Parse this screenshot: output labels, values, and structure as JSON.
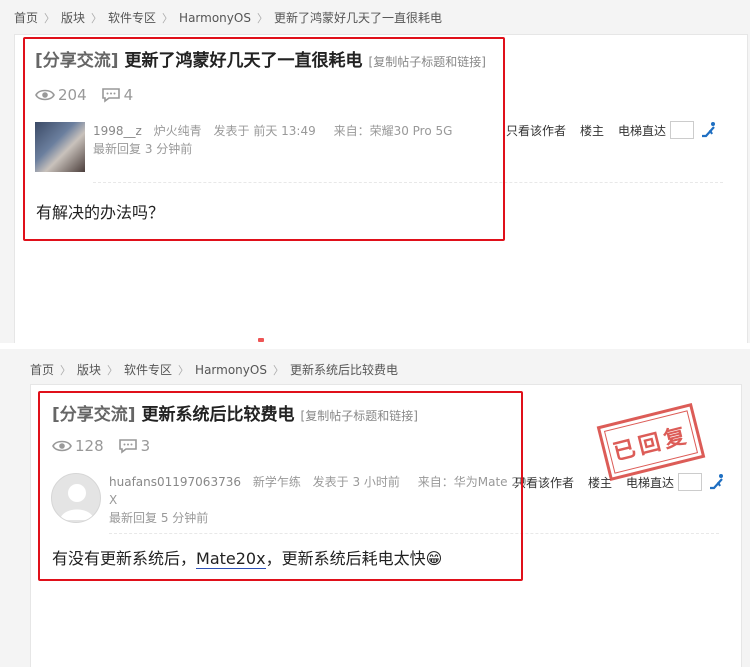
{
  "top": {
    "breadcrumb": [
      "首页",
      "版块",
      "软件专区",
      "HarmonyOS",
      "更新了鸿蒙好几天了一直很耗电"
    ],
    "post": {
      "category": "[分享交流]",
      "title": "更新了鸿蒙好几天了一直很耗电",
      "copy_link": "[复制帖子标题和链接]",
      "views": "204",
      "replies": "4",
      "username": "1998__z",
      "user_level": "炉火纯青",
      "posted": "发表于 前天 13:49",
      "source": "来自：荣耀30 Pro 5G",
      "last_reply": "最新回复 3 分钟前",
      "body": "有解决的办法吗？"
    },
    "tools": {
      "author_only": "只看该作者",
      "op": "楼主",
      "jump": "电梯直达"
    }
  },
  "bottom": {
    "breadcrumb": [
      "首页",
      "版块",
      "软件专区",
      "HarmonyOS",
      "更新系统后比较费电"
    ],
    "post": {
      "category": "[分享交流]",
      "title": "更新系统后比较费电",
      "copy_link": "[复制帖子标题和链接]",
      "views": "128",
      "replies": "3",
      "username": "huafans01197063736",
      "username_wrap": "X",
      "user_level": "新学乍练",
      "posted": "发表于 3 小时前",
      "source": "来自：华为Mate 20",
      "last_reply": "最新回复 5 分钟前",
      "body_before": "有没有更新系统后，",
      "body_link": "Mate20x",
      "body_after": "，更新系统后耗电太快😁"
    },
    "tools": {
      "author_only": "只看该作者",
      "op": "楼主",
      "jump": "电梯直达"
    },
    "stamp": "已回复"
  },
  "icons": {
    "views": "eye-icon",
    "replies": "comment-icon",
    "jump": "escalator-icon"
  },
  "colors": {
    "highlight_box": "#e0101a",
    "stamp": "#d7403a",
    "link_underline": "#2b4fb5"
  }
}
